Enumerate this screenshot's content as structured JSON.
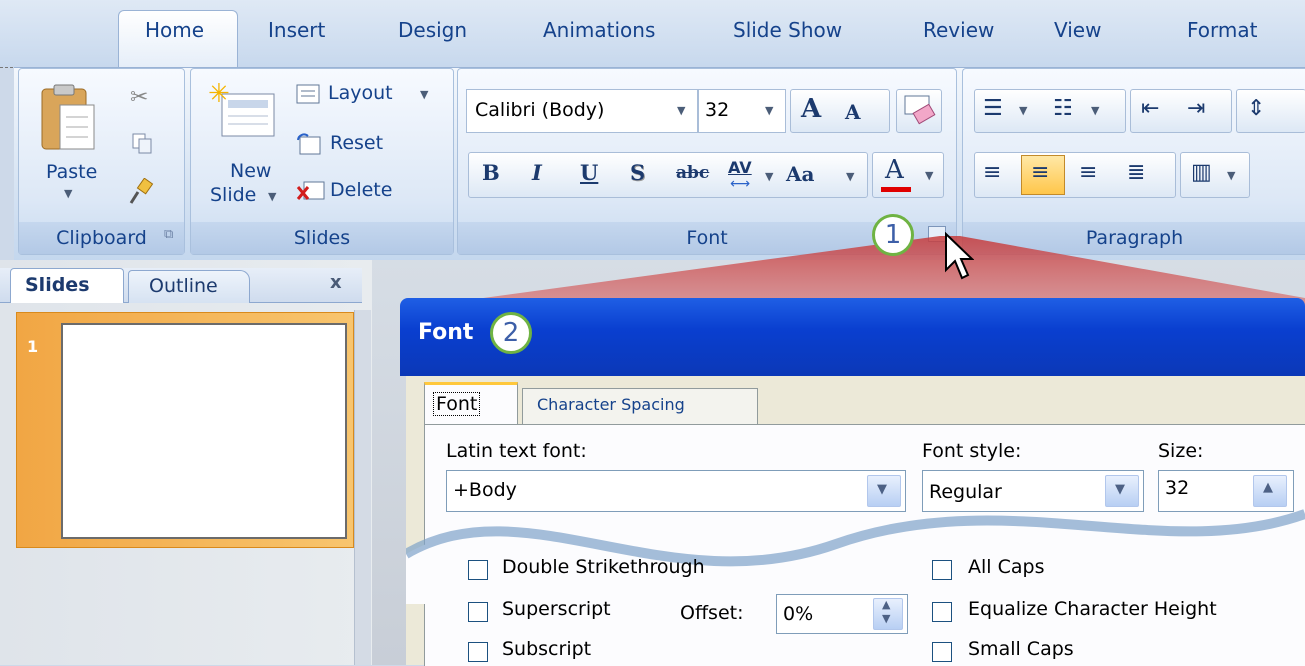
{
  "tabs": [
    "Home",
    "Insert",
    "Design",
    "Animations",
    "Slide Show",
    "Review",
    "View",
    "Format"
  ],
  "clipboard": {
    "paste": "Paste",
    "label": "Clipboard"
  },
  "slides_group": {
    "new": "New",
    "slide": "Slide",
    "layout": "Layout",
    "reset": "Reset",
    "delete": "Delete",
    "label": "Slides"
  },
  "font_group": {
    "font_name": "Calibri (Body)",
    "size": "32",
    "label": "Font",
    "grow": "A",
    "shrink": "A",
    "bold": "B",
    "italic": "I",
    "underline": "U",
    "shadow": "S",
    "strike": "abc",
    "spacing": "AV",
    "case": "Aa",
    "color": "A"
  },
  "paragraph_group": {
    "label": "Paragraph"
  },
  "pane": {
    "slides_tab": "Slides",
    "outline_tab": "Outline",
    "close": "x",
    "slide_number": "1"
  },
  "callouts": {
    "one": "1",
    "two": "2"
  },
  "dialog": {
    "title": "Font",
    "tab_font": "Font",
    "tab_spacing": "Character Spacing",
    "latin_label": "Latin text font:",
    "latin_value": "+Body",
    "style_label": "Font style:",
    "style_value": "Regular",
    "size_label": "Size:",
    "size_value": "32",
    "double_strike": "Double Strikethrough",
    "superscript": "Superscript",
    "subscript": "Subscript",
    "offset_label": "Offset:",
    "offset_value": "0%",
    "all_caps": "All Caps",
    "equalize": "Equalize Character Height",
    "small_caps": "Small Caps"
  },
  "colors": {
    "accent": "#15428b",
    "title_bar": "#0b3fd0",
    "slide_border": "#f39c2e",
    "font_color_bar": "#e00000"
  }
}
